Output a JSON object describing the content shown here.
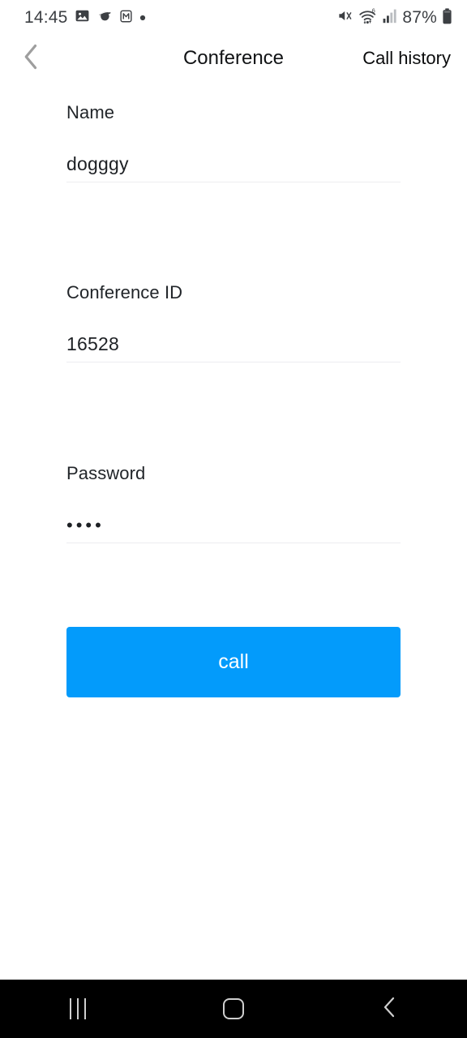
{
  "status_bar": {
    "time": "14:45",
    "left_icons": [
      "photo-icon",
      "saturn-icon",
      "boxed-m-icon",
      "dot-icon"
    ],
    "right_icons": [
      "mute-icon",
      "wifi-6-icon",
      "signal-bars-icon",
      "battery-icon"
    ],
    "battery_percent": "87%",
    "wifi_generation": "6"
  },
  "header": {
    "back_icon": "chevron-left-icon",
    "title": "Conference",
    "action_label": "Call history"
  },
  "form": {
    "fields": [
      {
        "label": "Name",
        "value": "dogggy",
        "masked": false,
        "placeholder": "Name"
      },
      {
        "label": "Conference ID",
        "value": "16528",
        "masked": false,
        "placeholder": "Conference ID"
      },
      {
        "label": "Password",
        "value": "••••",
        "masked": true,
        "placeholder": "Password"
      }
    ],
    "submit_label": "call"
  },
  "colors": {
    "accent": "#039bfb",
    "label_text": "#212529",
    "value_text": "#1d2024",
    "rule": "#ededf0",
    "background": "#ffffff",
    "navbar": "#000000",
    "back_chevron": "#9e9e9e"
  },
  "nav_bar": {
    "items": [
      {
        "icon": "recents-icon"
      },
      {
        "icon": "home-icon"
      },
      {
        "icon": "back-icon"
      }
    ]
  }
}
